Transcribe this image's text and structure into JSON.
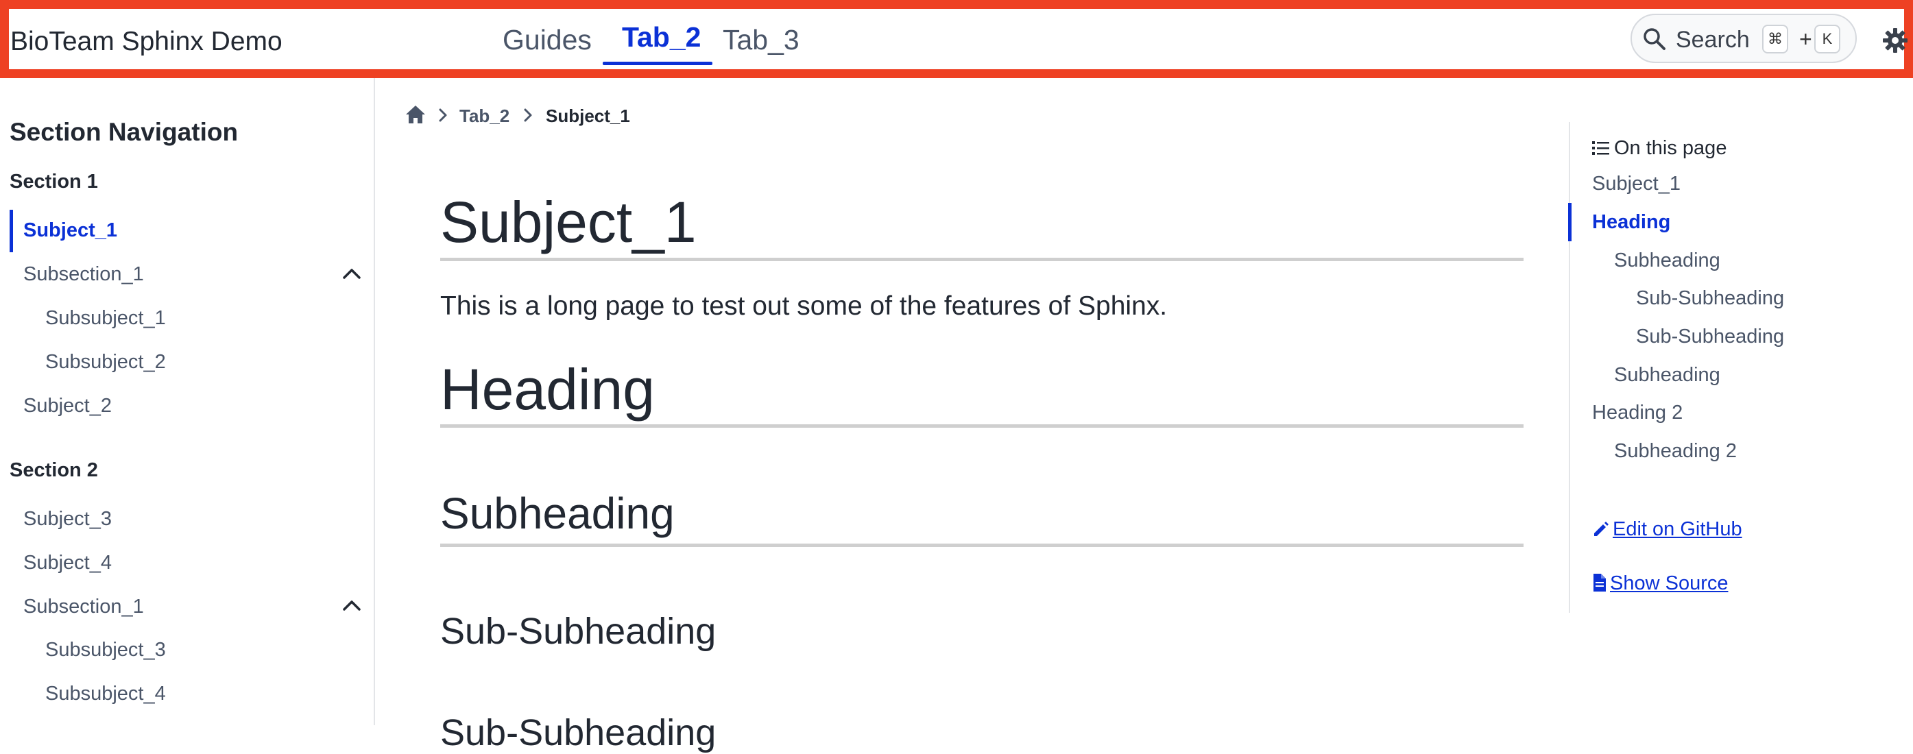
{
  "header": {
    "site_title": "BioTeam Sphinx Demo",
    "tabs": [
      {
        "label": "Guides",
        "active": false
      },
      {
        "label": "Tab_2",
        "active": true
      },
      {
        "label": "Tab_3",
        "active": false
      }
    ],
    "search": {
      "label": "Search",
      "shortcut_mod": "⌘",
      "shortcut_plus": "+",
      "shortcut_key": "K",
      "icon": "search-icon"
    },
    "theme_icon": "gear-icon",
    "accent_color": "#0b31d6",
    "highlight_border_color": "#ee4123"
  },
  "sidebar": {
    "heading": "Section Navigation",
    "sections": [
      {
        "caption": "Section 1",
        "items": [
          {
            "label": "Subject_1",
            "current": true
          },
          {
            "label": "Subsection_1",
            "expanded": true,
            "icon": "chevron-up-icon"
          },
          {
            "label": "Subsubject_1"
          },
          {
            "label": "Subsubject_2"
          },
          {
            "label": "Subject_2"
          }
        ]
      },
      {
        "caption": "Section 2",
        "items": [
          {
            "label": "Subject_3"
          },
          {
            "label": "Subject_4"
          },
          {
            "label": "Subsection_1",
            "expanded": true,
            "icon": "chevron-up-icon"
          },
          {
            "label": "Subsubject_3"
          },
          {
            "label": "Subsubject_4"
          }
        ]
      }
    ]
  },
  "breadcrumbs": {
    "home_icon": "home-icon",
    "items": [
      "Tab_2",
      "Subject_1"
    ]
  },
  "content": {
    "title": "Subject_1",
    "intro": "This is a long page to test out some of the features of Sphinx.",
    "heading": "Heading",
    "subheading": "Subheading",
    "subsubheading_1": "Sub-Subheading",
    "subsubheading_2": "Sub-Subheading"
  },
  "toc": {
    "title": "On this page",
    "title_icon": "list-icon",
    "items": [
      {
        "label": "Subject_1",
        "level": 0
      },
      {
        "label": "Heading",
        "level": 0,
        "active": true
      },
      {
        "label": "Subheading",
        "level": 1
      },
      {
        "label": "Sub-Subheading",
        "level": 2
      },
      {
        "label": "Sub-Subheading",
        "level": 2
      },
      {
        "label": "Subheading",
        "level": 1
      },
      {
        "label": "Heading 2",
        "level": 0
      },
      {
        "label": "Subheading 2",
        "level": 1
      }
    ],
    "edit_link": "Edit on GitHub",
    "edit_icon": "pencil-icon",
    "source_link": "Show Source",
    "source_icon": "file-icon"
  }
}
